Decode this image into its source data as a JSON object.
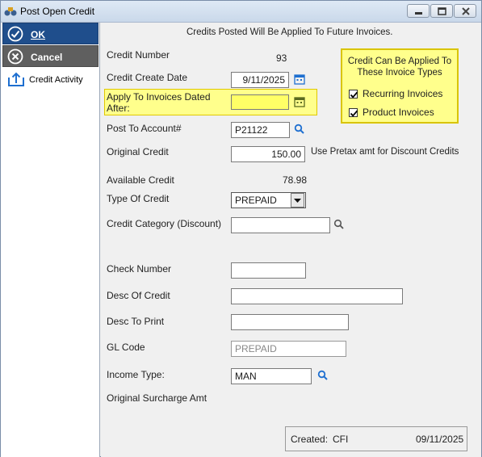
{
  "window": {
    "title": "Post Open Credit"
  },
  "sidebar": {
    "ok_label": "OK",
    "cancel_label": "Cancel",
    "activity_label": "Credit Activity"
  },
  "form": {
    "header_note": "Credits Posted Will Be Applied To Future Invoices.",
    "credit_number": {
      "label": "Credit Number",
      "value": "93"
    },
    "credit_create_date": {
      "label": "Credit Create Date",
      "value": "9/11/2025"
    },
    "apply_dated_after": {
      "label_line1": "Apply To Invoices Dated",
      "label_line2": "After:",
      "value": ""
    },
    "post_to_account": {
      "label": "Post To Account#",
      "value": "P21122"
    },
    "original_credit": {
      "label": "Original Credit",
      "value": "150.00",
      "note": "Use Pretax amt for Discount Credits"
    },
    "available_credit": {
      "label": "Available Credit",
      "value": "78.98"
    },
    "type_of_credit": {
      "label": "Type Of Credit",
      "value": "PREPAID"
    },
    "credit_category": {
      "label": "Credit Category (Discount)",
      "value": ""
    },
    "check_number": {
      "label": "Check Number",
      "value": ""
    },
    "desc_of_credit": {
      "label": "Desc Of Credit",
      "value": ""
    },
    "desc_to_print": {
      "label": "Desc To Print",
      "value": ""
    },
    "gl_code": {
      "label": "GL Code",
      "value": "PREPAID"
    },
    "income_type": {
      "label": "Income Type:",
      "value": "MAN"
    },
    "original_surcharge": {
      "label": "Original Surcharge Amt"
    }
  },
  "apply_box": {
    "title_line1": "Credit Can Be Applied To",
    "title_line2": "These Invoice Types",
    "options": [
      {
        "label": "Recurring Invoices",
        "checked": true
      },
      {
        "label": "Product Invoices",
        "checked": true
      }
    ]
  },
  "footer": {
    "created_label": "Created:",
    "created_by": "CFI",
    "created_date": "09/11/2025"
  },
  "colors": {
    "ok_bg": "#1f4e8c",
    "cancel_bg": "#5f5f5f",
    "highlight": "#ffff8c",
    "icon_blue": "#1e6fd0"
  }
}
